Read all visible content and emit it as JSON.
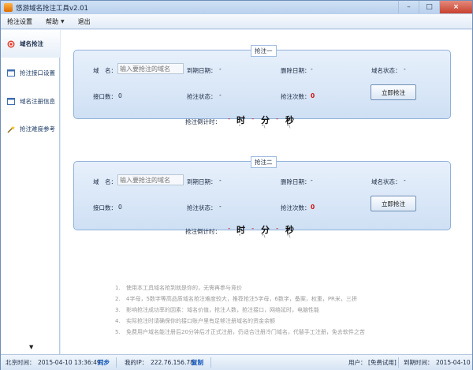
{
  "window": {
    "title": "悠游域名抢注工具v2.01",
    "minimize": "–",
    "maximize": "□",
    "close": "×"
  },
  "menu": {
    "items": [
      "抢注设置",
      "帮助",
      "退出"
    ]
  },
  "sidebar": {
    "items": [
      {
        "label": "域名抢注",
        "icon": "target-icon"
      },
      {
        "label": "抢注接口设置",
        "icon": "window-icon"
      },
      {
        "label": "域名注册信息",
        "icon": "window-icon"
      },
      {
        "label": "抢注难度参考",
        "icon": "wand-icon"
      }
    ],
    "scroll_arrow": "▼"
  },
  "panels": [
    {
      "legend": "抢注一",
      "domain_label": "域　名：",
      "domain_placeholder": "输入要抢注的域名",
      "expire_label": "到期日期：",
      "expire_value": "-",
      "delete_label": "删除日期：",
      "delete_value": "-",
      "status_label": "域名状态：",
      "status_value": "-",
      "interfaces_label": "接口数：",
      "interfaces_value": "0",
      "grab_status_label": "抢注状态：",
      "grab_status_value": "-",
      "grab_count_label": "抢注次数：",
      "grab_count_value": "0",
      "grab_button": "立即抢注",
      "countdown_label": "抢注倒计时：",
      "countdown": {
        "sep": "-",
        "hour": "时",
        "minute": "分",
        "second": "秒",
        "hour_sub": "\"",
        "minute_sub": "\"\\",
        "second_sub": "\"\\"
      }
    },
    {
      "legend": "抢注二",
      "domain_label": "域　名：",
      "domain_placeholder": "输入要抢注的域名",
      "expire_label": "到期日期：",
      "expire_value": "-",
      "delete_label": "删除日期：",
      "delete_value": "-",
      "status_label": "域名状态：",
      "status_value": "-",
      "interfaces_label": "接口数：",
      "interfaces_value": "0",
      "grab_status_label": "抢注状态：",
      "grab_status_value": "-",
      "grab_count_label": "抢注次数：",
      "grab_count_value": "0",
      "grab_button": "立即抢注",
      "countdown_label": "抢注倒计时：",
      "countdown": {
        "sep": "-",
        "hour": "时",
        "minute": "分",
        "second": "秒",
        "hour_sub": "\"",
        "minute_sub": "\"\\",
        "second_sub": "\"\\"
      }
    }
  ],
  "notes": [
    {
      "num": "1.",
      "text": "使用本工具域名抢到就是你的，无需再参与竞价"
    },
    {
      "num": "2.",
      "text": "4字母，5数字等高品质域名抢注难度较大，推荐抢注5字母，6数字，备案，权重，PR米，三拼"
    },
    {
      "num": "3.",
      "text": "影响抢注成功率的因素：域名价值，抢注人数，抢注接口，网络延时，电脑性能"
    },
    {
      "num": "4.",
      "text": "实际抢注时请确保你的接口账户里有足够注册域名的资金余额"
    },
    {
      "num": "5.",
      "text": "免费用户域名能注册后20分钟后才正式注册，仍适合注册冷门域名，代替手工注册，免去软件之苦"
    }
  ],
  "statusbar": {
    "beijing_time_label": "北京时间：",
    "beijing_time": "2015-04-10 13:36:49",
    "sync": "同步",
    "ip_label": "我的IP：",
    "ip": "222.76.156.78",
    "copy": "复制",
    "user_label": "用户：",
    "user_value": "[免费试用]",
    "expire_label": "到期时间：",
    "expire_value": "2015-04-10"
  }
}
